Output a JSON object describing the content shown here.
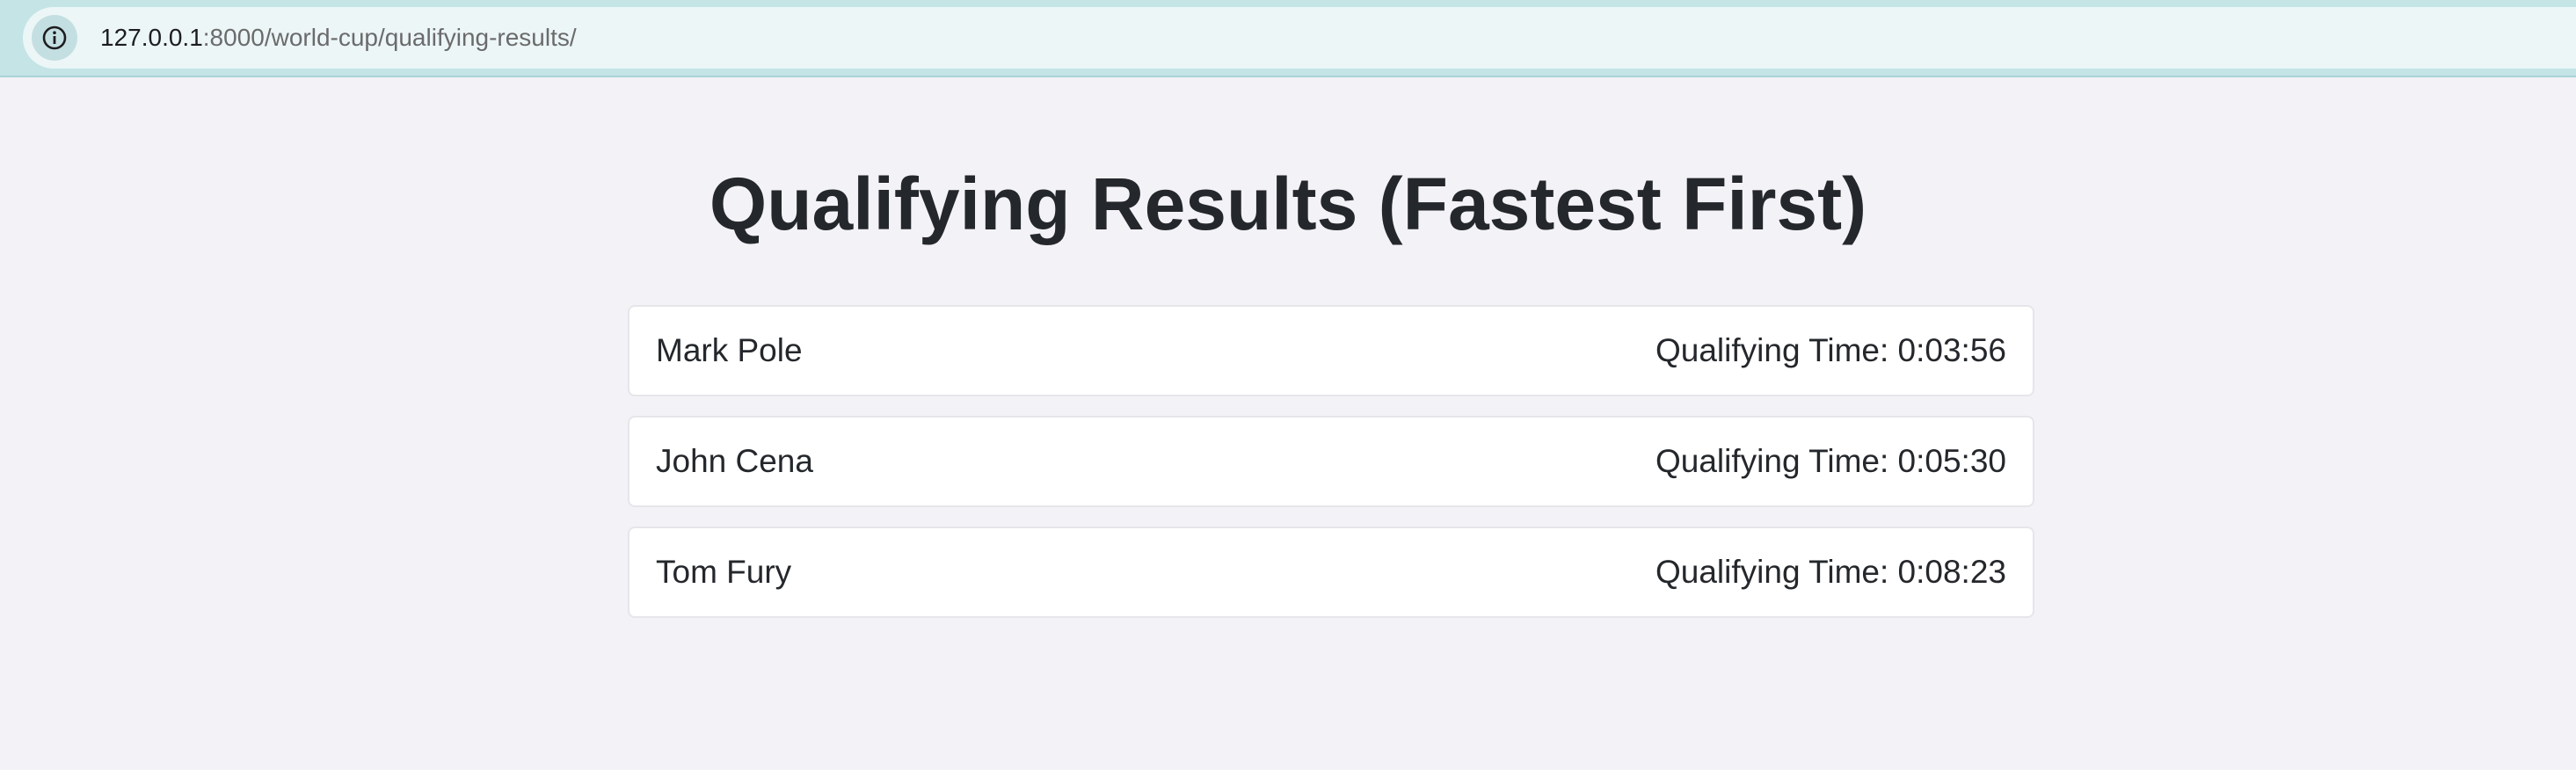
{
  "browser": {
    "url_host": "127.0.0.1",
    "url_rest": ":8000/world-cup/qualifying-results/"
  },
  "page": {
    "title": "Qualifying Results (Fastest First)"
  },
  "results": [
    {
      "name": "Mark Pole",
      "time": "Qualifying Time: 0:03:56"
    },
    {
      "name": "John Cena",
      "time": "Qualifying Time: 0:05:30"
    },
    {
      "name": "Tom Fury",
      "time": "Qualifying Time: 0:08:23"
    }
  ]
}
